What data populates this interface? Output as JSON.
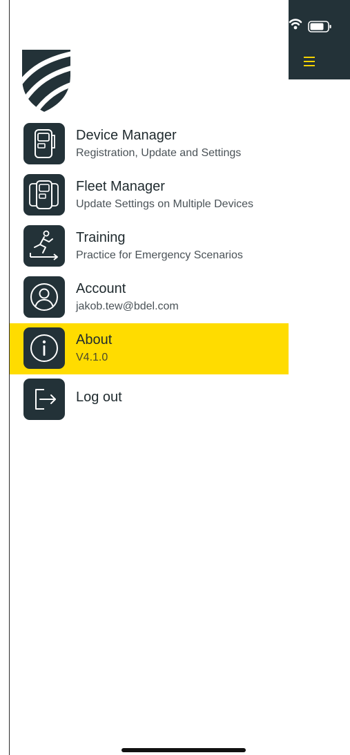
{
  "colors": {
    "panel": "#233238",
    "accent": "#ffdc00",
    "hamburger": "#f5d300",
    "text_primary": "#1f2a2e",
    "text_secondary": "#4a5257"
  },
  "status_bar": {
    "icons": [
      "wifi-icon",
      "battery-icon"
    ]
  },
  "header": {
    "menu_icon": "hamburger-menu-icon",
    "logo_icon": "brand-shield-logo"
  },
  "menu": {
    "items": [
      {
        "title": "Device Manager",
        "subtitle": "Registration, Update and Settings",
        "icon": "device-icon",
        "active": false
      },
      {
        "title": "Fleet Manager",
        "subtitle": "Update Settings on Multiple Devices",
        "icon": "fleet-devices-icon",
        "active": false
      },
      {
        "title": "Training",
        "subtitle": "Practice for Emergency Scenarios",
        "icon": "running-person-icon",
        "active": false
      },
      {
        "title": "Account",
        "subtitle": "jakob.tew@bdel.com",
        "icon": "user-icon",
        "active": false
      },
      {
        "title": "About",
        "subtitle": "V4.1.0",
        "icon": "info-icon",
        "active": true
      },
      {
        "title": "Log out",
        "subtitle": "",
        "icon": "logout-icon",
        "active": false
      }
    ]
  }
}
